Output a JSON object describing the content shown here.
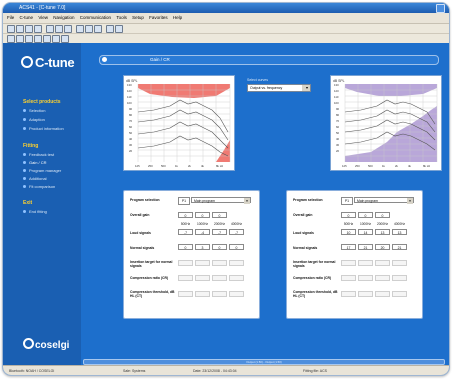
{
  "window": {
    "title": "ACS41 - [C-tune 7.0]"
  },
  "menu": [
    "File",
    "C-tune",
    "View",
    "Navigation",
    "Communication",
    "Tools",
    "Setup",
    "Favorites",
    "Help"
  ],
  "sidebar": {
    "logo": "C-tune",
    "sections": [
      {
        "head": "Select products",
        "items": [
          "Selection",
          "Adaption",
          "Product information"
        ]
      },
      {
        "head": "Fitting",
        "items": [
          "Feedback test",
          "Gain / CR",
          "Program manager",
          "Additional",
          "Fit comparison"
        ]
      },
      {
        "head": "Exit",
        "items": [
          "End fitting"
        ]
      }
    ],
    "selected": "Gain / CR",
    "brand": "coselgi"
  },
  "content": {
    "tab_label": "Gain / CR",
    "dropdown_label": "Select curves",
    "dropdown_value": "Output vs. frequency",
    "graph_left_ylabel": "dB SPL",
    "graph_right_ylabel": "dB SPL",
    "yticks": [
      "130",
      "120",
      "110",
      "100",
      "90",
      "80",
      "70",
      "60",
      "50",
      "40",
      "30",
      "20"
    ],
    "xticks": [
      "125",
      "250",
      "500",
      "1k",
      "2k",
      "4k",
      "8k Hz"
    ]
  },
  "panels": [
    {
      "program_label": "Program selection",
      "program_num": "P1",
      "program_name": "Main program",
      "overall_label": "Overall gain",
      "overall": [
        "0",
        "0",
        "0"
      ],
      "hz": [
        "500Hz",
        "1000Hz",
        "2000Hz",
        "4000Hz"
      ],
      "loud_label": "Loud signals",
      "loud": [
        "-7",
        "-4",
        "-7",
        "-7"
      ],
      "normal_label": "Normal signals",
      "normal": [
        "0",
        "3",
        "0",
        "0"
      ],
      "insertion_label": "Insertion target for normal signals",
      "insertion": [
        "",
        "",
        "",
        ""
      ],
      "cr_label": "Compression ratio (CR)",
      "cr": [
        "",
        "",
        "",
        ""
      ],
      "ct_label": "Compression threshold, dB HL (CT)",
      "ct": [
        "",
        "",
        "",
        ""
      ]
    },
    {
      "program_label": "Program selection",
      "program_num": "P1",
      "program_name": "Main program",
      "overall_label": "Overall gain",
      "overall": [
        "0",
        "0",
        "0"
      ],
      "hz": [
        "500Hz",
        "1000Hz",
        "2000Hz",
        "4000Hz"
      ],
      "loud_label": "Loud signals",
      "loud": [
        "10",
        "14",
        "13",
        "13"
      ],
      "normal_label": "Normal signals",
      "normal": [
        "17",
        "21",
        "20",
        "21"
      ],
      "insertion_label": "Insertion target for normal signals",
      "insertion": [
        "",
        "",
        "",
        ""
      ],
      "cr_label": "Compression ratio (CR)",
      "cr": [
        "",
        "",
        "",
        ""
      ],
      "ct_label": "Compression threshold, dB HL (CT)",
      "ct": [
        "",
        "",
        "",
        ""
      ]
    }
  ],
  "progress": "Output (1.50) - Output (1.50)",
  "status": [
    "Bluetooth: NOAH / COSELGI",
    "Sale: Systems",
    "Date: 23/12/2008 - 04:43:04",
    "Fitting file: ACS"
  ],
  "colors": {
    "left_fill": "#f07a73",
    "right_fill": "#b9a7d9",
    "bg": "#1d6fcc"
  }
}
